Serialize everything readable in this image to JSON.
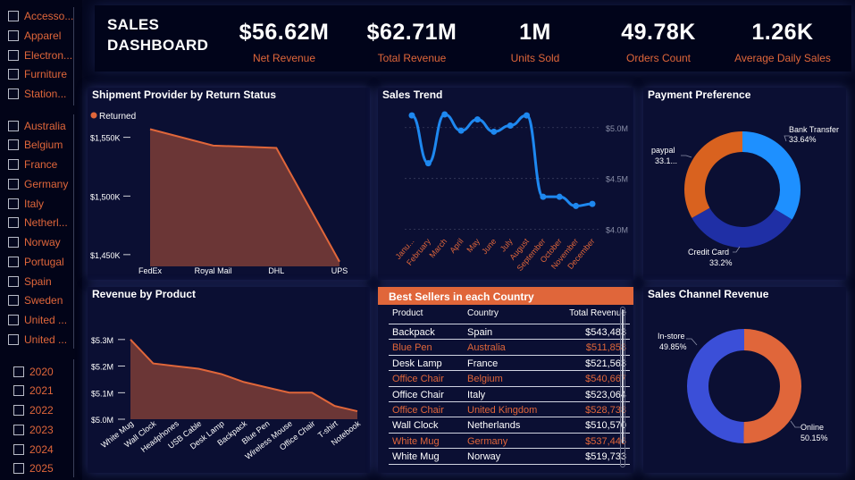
{
  "filters": {
    "categories": [
      "Accesso...",
      "Apparel",
      "Electron...",
      "Furniture",
      "Station..."
    ],
    "countries": [
      "Australia",
      "Belgium",
      "France",
      "Germany",
      "Italy",
      "Netherl...",
      "Norway",
      "Portugal",
      "Spain",
      "Sweden",
      "United ...",
      "United ..."
    ],
    "years": [
      "2020",
      "2021",
      "2022",
      "2023",
      "2024",
      "2025"
    ]
  },
  "header": {
    "title_line1": "SALES",
    "title_line2": "DASHBOARD",
    "kpis": [
      {
        "value": "$56.62M",
        "label": "Net Revenue"
      },
      {
        "value": "$62.71M",
        "label": "Total Revenue"
      },
      {
        "value": "1M",
        "label": "Units  Sold"
      },
      {
        "value": "49.78K",
        "label": "Orders Count"
      },
      {
        "value": "1.26K",
        "label": "Average Daily Sales"
      }
    ]
  },
  "colors": {
    "accent": "#e0663a",
    "blue_line": "#1e88f0",
    "pie_blue": "#1e90ff",
    "pie_navy": "#1f2fa5",
    "pie_orange": "#d9621f",
    "donut_blue": "#3b4fd8",
    "donut_orange": "#e0663a"
  },
  "chart_data": [
    {
      "type": "area",
      "title": "Shipment Provider by Return Status",
      "legend": [
        "Returned"
      ],
      "categories": [
        "FedEx",
        "Royal Mail",
        "DHL",
        "UPS"
      ],
      "series": [
        {
          "name": "Returned",
          "values": [
            1557000,
            1543000,
            1541000,
            1444000
          ]
        }
      ],
      "ylim": [
        1440000,
        1565000
      ],
      "yticks": [
        1450000,
        1500000,
        1550000
      ],
      "ytick_labels": [
        "$1,450K",
        "$1,500K",
        "$1,550K"
      ]
    },
    {
      "type": "line",
      "title": "Sales Trend",
      "categories": [
        "January",
        "February",
        "March",
        "April",
        "May",
        "June",
        "July",
        "August",
        "September",
        "October",
        "November",
        "December"
      ],
      "category_labels": [
        "Janu...",
        "February",
        "March",
        "April",
        "May",
        "June",
        "July",
        "August",
        "September",
        "October",
        "November",
        "December"
      ],
      "values": [
        5.12,
        4.65,
        5.13,
        4.97,
        5.08,
        4.96,
        5.02,
        5.12,
        4.32,
        4.32,
        4.23,
        4.25
      ],
      "ylim": [
        3.9,
        5.2
      ],
      "yticks": [
        4.0,
        4.5,
        5.0
      ],
      "ytick_labels": [
        "$4.0M",
        "$4.5M",
        "$5.0M"
      ]
    },
    {
      "type": "pie",
      "title": "Payment Preference",
      "labels": [
        "Bank Transfer",
        "Credit Card",
        "paypal"
      ],
      "values": [
        33.64,
        33.2,
        33.16
      ],
      "value_labels": [
        "33.64%",
        "33.2%",
        "33.1..."
      ]
    },
    {
      "type": "area",
      "title": "Revenue by Product",
      "categories": [
        "White Mug",
        "Wall Clock",
        "Headphones",
        "USB Cable",
        "Desk Lamp",
        "Backpack",
        "Blue Pen",
        "Wireless Mouse",
        "Office Chair",
        "T-shirt",
        "Notebook"
      ],
      "values": [
        5.3,
        5.21,
        5.2,
        5.19,
        5.17,
        5.14,
        5.12,
        5.1,
        5.1,
        5.05,
        5.03
      ],
      "ylim": [
        5.0,
        5.35
      ],
      "yticks": [
        5.0,
        5.1,
        5.2,
        5.3
      ],
      "ytick_labels": [
        "$5.0M",
        "$5.1M",
        "$5.2M",
        "$5.3M"
      ]
    },
    {
      "type": "table",
      "title": "Best Sellers in each Country",
      "columns": [
        "Product",
        "Country",
        "Total Revenue"
      ],
      "rows": [
        [
          "Backpack",
          "Spain",
          "$543,483"
        ],
        [
          "Blue Pen",
          "Australia",
          "$511,858"
        ],
        [
          "Desk Lamp",
          "France",
          "$521,563"
        ],
        [
          "Office Chair",
          "Belgium",
          "$540,667"
        ],
        [
          "Office Chair",
          "Italy",
          "$523,064"
        ],
        [
          "Office Chair",
          "United Kingdom",
          "$528,738"
        ],
        [
          "Wall Clock",
          "Netherlands",
          "$510,570"
        ],
        [
          "White Mug",
          "Germany",
          "$537,446"
        ],
        [
          "White Mug",
          "Norway",
          "$519,733"
        ]
      ]
    },
    {
      "type": "pie",
      "title": "Sales Channel Revenue",
      "labels": [
        "In-store",
        "Online"
      ],
      "values": [
        49.85,
        50.15
      ],
      "value_labels": [
        "49.85%",
        "50.15%"
      ]
    }
  ]
}
